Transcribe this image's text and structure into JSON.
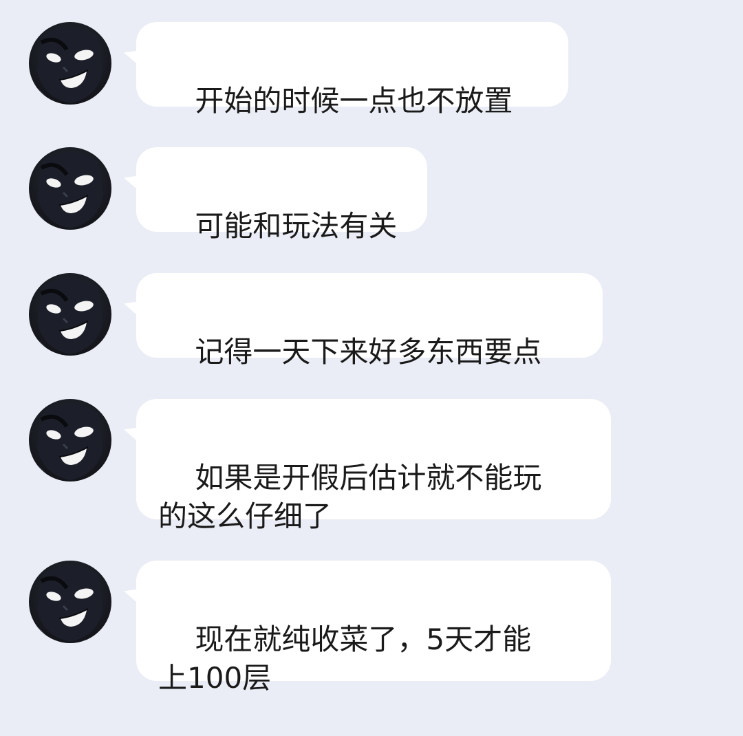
{
  "messages": [
    {
      "text": "开始的时候一点也不放置"
    },
    {
      "text": "可能和玩法有关"
    },
    {
      "text": "记得一天下来好多东西要点"
    },
    {
      "text": "如果是开假后估计就不能玩\n的这么仔细了"
    },
    {
      "text": "现在就纯收菜了，5天才能\n上100层"
    }
  ],
  "colors": {
    "background": "#eaedf5",
    "bubble": "#ffffff",
    "text": "#1a1a1a"
  }
}
